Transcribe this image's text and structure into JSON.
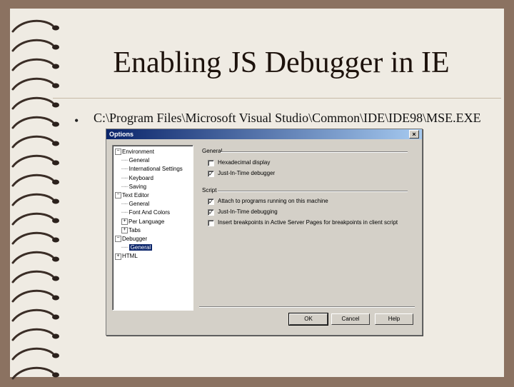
{
  "slide": {
    "title": "Enabling JS Debugger in IE",
    "bullet_symbol": "•",
    "bullet": "C:\\Program Files\\Microsoft Visual Studio\\Common\\IDE\\IDE98\\MSE.EXE"
  },
  "dialog": {
    "title": "Options",
    "close_glyph": "×",
    "tree": [
      {
        "label": "Environment",
        "level": 0,
        "toggle": "−"
      },
      {
        "label": "General",
        "level": 1
      },
      {
        "label": "International Settings",
        "level": 1
      },
      {
        "label": "Keyboard",
        "level": 1
      },
      {
        "label": "Saving",
        "level": 1
      },
      {
        "label": "Text Editor",
        "level": 0,
        "toggle": "−"
      },
      {
        "label": "General",
        "level": 1
      },
      {
        "label": "Font And Colors",
        "level": 1
      },
      {
        "label": "Per Language",
        "level": 1,
        "toggle": "+"
      },
      {
        "label": "Tabs",
        "level": 1,
        "toggle": "+"
      },
      {
        "label": "Debugger",
        "level": 0,
        "toggle": "−"
      },
      {
        "label": "General",
        "level": 1,
        "selected": true
      },
      {
        "label": "HTML",
        "level": 0,
        "toggle": "+"
      }
    ],
    "general_group": {
      "label": "General",
      "options": [
        {
          "label": "Hexadecimal display",
          "checked": false
        },
        {
          "label": "Just-In-Time debugger",
          "checked": true
        }
      ]
    },
    "script_group": {
      "label": "Script",
      "options": [
        {
          "label": "Attach to programs running on this machine",
          "checked": true
        },
        {
          "label": "Just-In-Time debugging",
          "checked": true
        },
        {
          "label": "Insert breakpoints in Active Server Pages for breakpoints in client script",
          "checked": false
        }
      ]
    },
    "buttons": {
      "ok": "OK",
      "cancel": "Cancel",
      "help": "Help"
    }
  }
}
